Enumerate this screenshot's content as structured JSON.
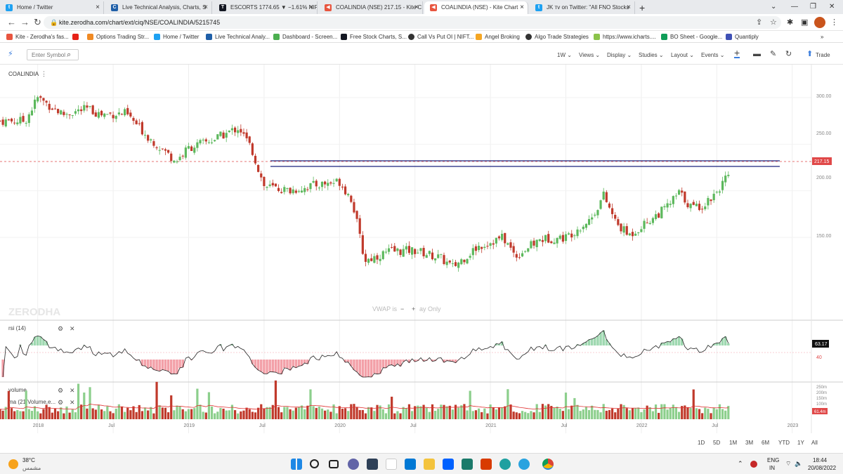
{
  "browser": {
    "tabs": [
      {
        "label": "Home / Twitter",
        "icon": "twitter-icon"
      },
      {
        "label": "Live Technical Analysis, Charts, S",
        "icon": "chartink-icon"
      },
      {
        "label": "ESCORTS 1774.65 ▼ −1.61% NIF",
        "icon": "tradingview-icon"
      },
      {
        "label": "COALINDIA (NSE) 217.15 - Kite C",
        "icon": "kite-icon"
      },
      {
        "label": "COALINDIA (NSE) - Kite Chart",
        "icon": "kite-icon"
      },
      {
        "label": "JK ᴛᴠ on Twitter: \"All FNO Stocks",
        "icon": "twitter-icon"
      }
    ],
    "url": "kite.zerodha.com/chart/ext/ciq/NSE/COALINDIA/5215745",
    "bookmarks": [
      "Kite - Zerodha's fas...",
      "Options Trading Str...",
      "Home / Twitter",
      "Live Technical Analy...",
      "Dashboard - Screen...",
      "Free Stock Charts, S...",
      "Call Vs Put OI | NIFT...",
      "Angel Broking",
      "Algo Trade Strategies",
      "https://www.icharts....",
      "BO Sheet - Google...",
      "Quantiply"
    ],
    "more_bookmarks": "»"
  },
  "toolbar": {
    "symbol_placeholder": "Enter Symbol",
    "interval": "1W",
    "menus": [
      "Views",
      "Display",
      "Studies",
      "Layout",
      "Events"
    ],
    "trade_label": "Trade"
  },
  "chart": {
    "symbol": "COALINDIA",
    "watermark": "ZERODHA",
    "vwap_note": "VWAP is",
    "vwap_note_tail": "ay Only",
    "price_labels": [
      "300.00",
      "250.00",
      "200.00",
      "150.00"
    ],
    "last_price": "217.15",
    "rsi_panel_label": "rsi (14)",
    "rsi_value": "63.17",
    "rsi_level_40": "40",
    "volume_panel_label": "volume",
    "ma_panel_label": "ma (21,Volume,e...",
    "volume_scale_labels": [
      "250m",
      "200m",
      "150m",
      "100m"
    ],
    "volume_ma_value": "61.4m",
    "x_labels": [
      "2018",
      "Jul",
      "2019",
      "Jul",
      "2020",
      "Jul",
      "2021",
      "Jul",
      "2022",
      "Jul",
      "2023"
    ],
    "colors": {
      "up": "#5cb85c",
      "down": "#c0392b",
      "last_price": "#e04848",
      "resistance": "#1a237e",
      "rsi_overbought": "#9ed8b0",
      "rsi_oversold": "#f3a0a8",
      "vol_ma": "#e03030"
    }
  },
  "chart_data": {
    "type": "candlestick",
    "interval": "1W",
    "x_range": [
      "2017-10",
      "2023-01"
    ],
    "y_range": [
      110,
      320
    ],
    "resistance_zone": [
      211,
      218
    ],
    "last_close": 217.15,
    "approx_weekly_path": [
      {
        "date": "2017-10",
        "close": 275
      },
      {
        "date": "2017-12",
        "close": 275
      },
      {
        "date": "2018-01",
        "close": 300
      },
      {
        "date": "2018-03",
        "close": 282
      },
      {
        "date": "2018-05",
        "close": 288
      },
      {
        "date": "2018-06",
        "close": 282
      },
      {
        "date": "2018-08",
        "close": 283
      },
      {
        "date": "2018-10",
        "close": 255
      },
      {
        "date": "2018-12",
        "close": 232
      },
      {
        "date": "2019-01",
        "close": 246
      },
      {
        "date": "2019-03",
        "close": 255
      },
      {
        "date": "2019-05",
        "close": 268
      },
      {
        "date": "2019-06",
        "close": 245
      },
      {
        "date": "2019-07",
        "close": 205
      },
      {
        "date": "2019-09",
        "close": 200
      },
      {
        "date": "2019-11",
        "close": 206
      },
      {
        "date": "2020-01",
        "close": 210
      },
      {
        "date": "2020-02",
        "close": 190
      },
      {
        "date": "2020-03",
        "close": 125
      },
      {
        "date": "2020-05",
        "close": 135
      },
      {
        "date": "2020-07",
        "close": 136
      },
      {
        "date": "2020-09",
        "close": 128
      },
      {
        "date": "2020-10",
        "close": 118
      },
      {
        "date": "2020-12",
        "close": 140
      },
      {
        "date": "2021-02",
        "close": 150
      },
      {
        "date": "2021-03",
        "close": 130
      },
      {
        "date": "2021-05",
        "close": 148
      },
      {
        "date": "2021-07",
        "close": 150
      },
      {
        "date": "2021-09",
        "close": 170
      },
      {
        "date": "2021-10",
        "close": 195
      },
      {
        "date": "2021-11",
        "close": 165
      },
      {
        "date": "2021-12",
        "close": 152
      },
      {
        "date": "2022-01",
        "close": 162
      },
      {
        "date": "2022-03",
        "close": 182
      },
      {
        "date": "2022-04",
        "close": 198
      },
      {
        "date": "2022-05",
        "close": 182
      },
      {
        "date": "2022-06",
        "close": 185
      },
      {
        "date": "2022-07",
        "close": 200
      },
      {
        "date": "2022-08",
        "close": 217.15
      }
    ],
    "rsi_last": 63.17,
    "volume_ma_last_m": 61.4
  },
  "bottom_bar": {
    "ranges": [
      "1D",
      "5D",
      "1M",
      "3M",
      "6M",
      "YTD",
      "1Y",
      "All"
    ]
  },
  "taskbar": {
    "weather_temp": "38°C",
    "weather_desc": "مشمس",
    "lang_top": "ENG",
    "lang_bottom": "IN",
    "time": "18:44",
    "date": "20/08/2022"
  }
}
